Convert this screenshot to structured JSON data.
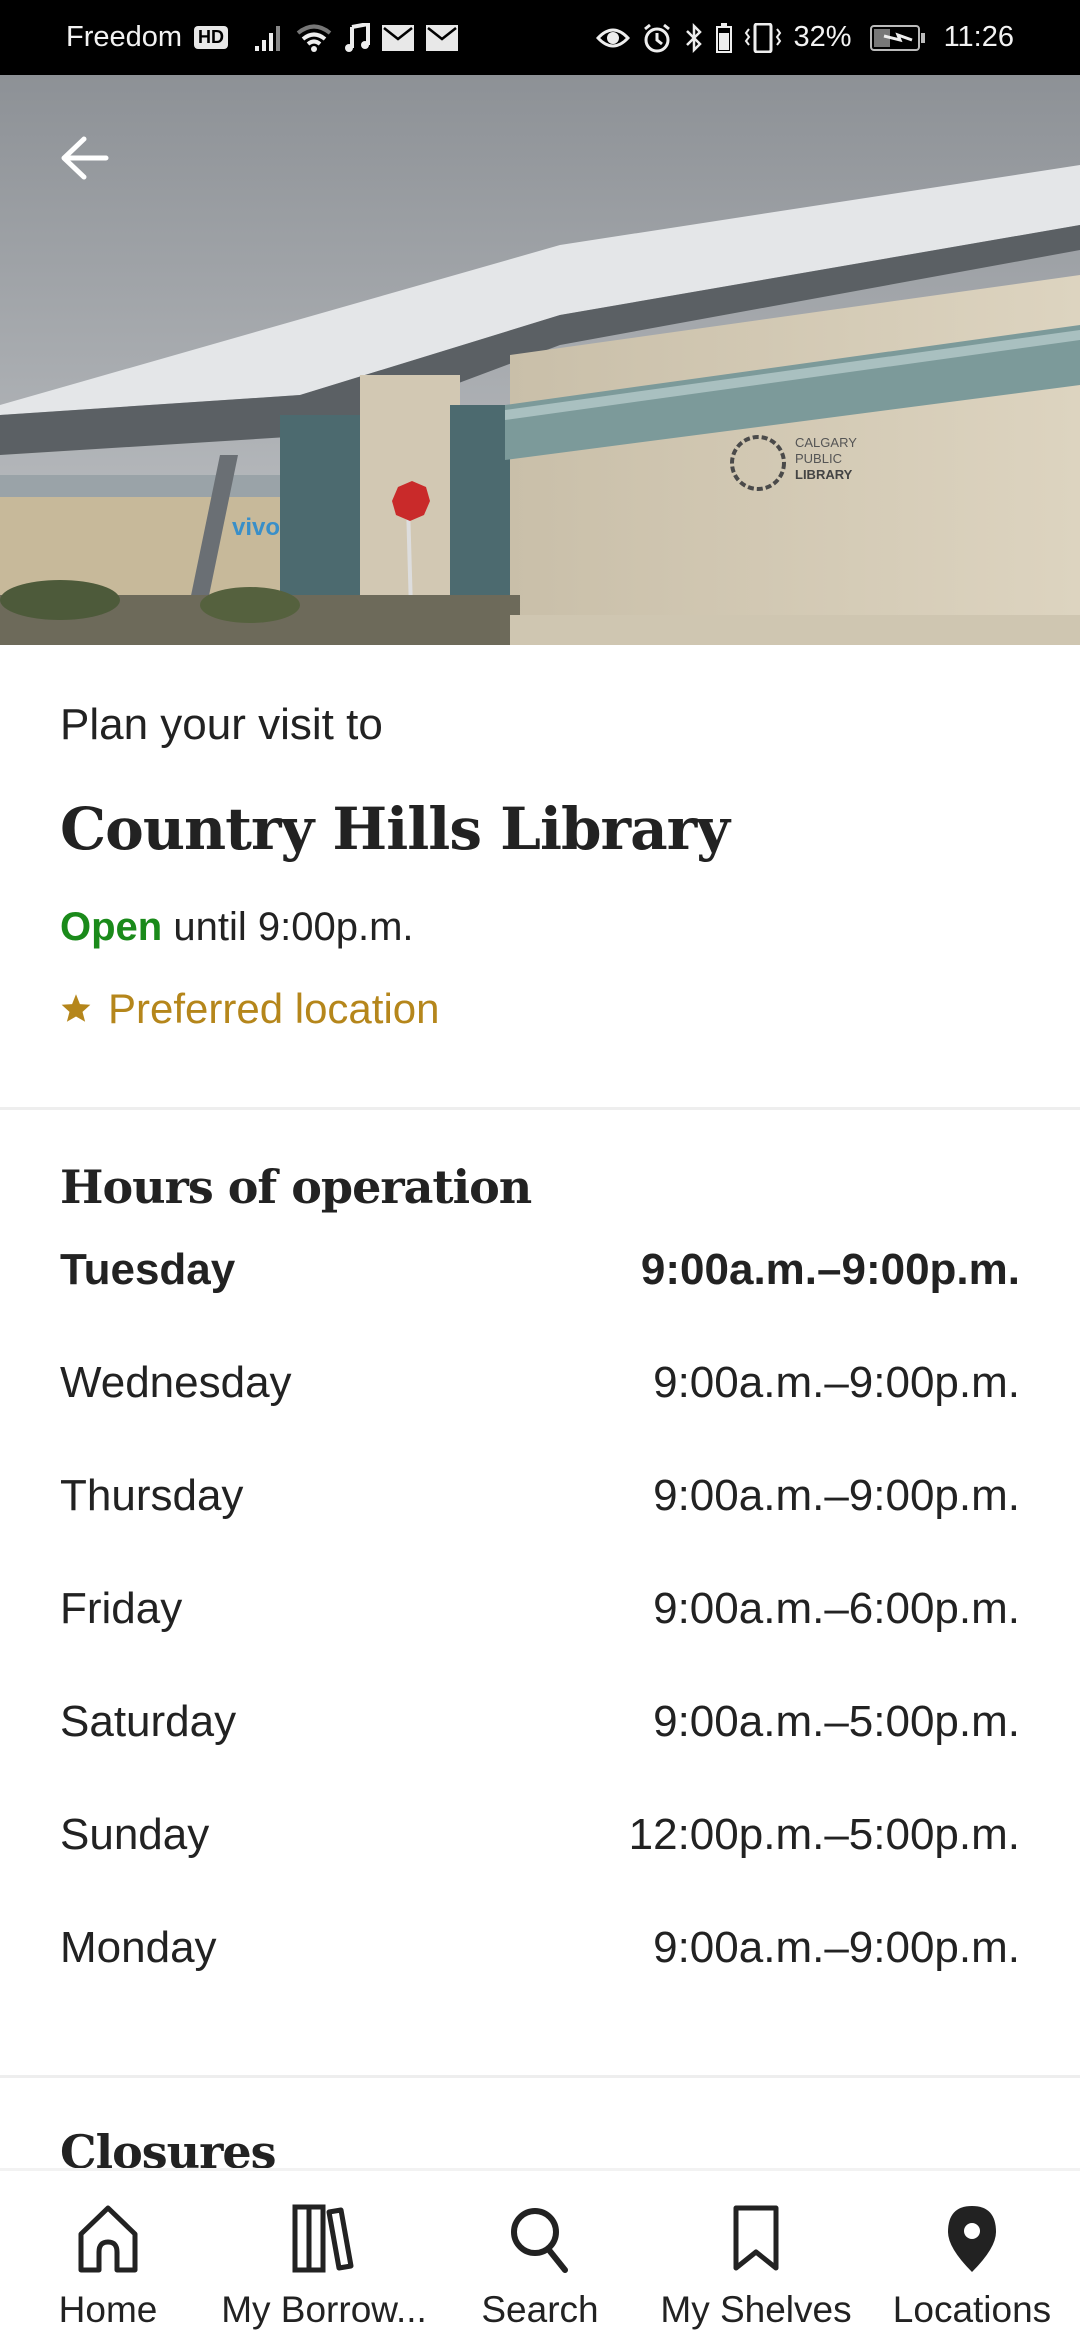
{
  "status_bar": {
    "carrier": "Freedom",
    "network_badge": "HD",
    "left_icons": [
      "signal-icon",
      "wifi-icon",
      "music-icon",
      "mail-icon",
      "mail-icon"
    ],
    "right_icons": [
      "eye-icon",
      "alarm-icon",
      "bluetooth-icon",
      "vibrate-icon"
    ],
    "battery_percent": "32%",
    "time": "11:26"
  },
  "header": {
    "back_icon": "arrow-left-icon",
    "hero_image_alt": "Country Hills Library building exterior",
    "building_sign": "CALGARY PUBLIC LIBRARY",
    "stop_sign": "STOP"
  },
  "intro": {
    "plan_label": "Plan your visit to",
    "library_name": "Country Hills Library",
    "open_status": "Open",
    "open_until": "until 9:00p.m.",
    "preferred_label": "Preferred location",
    "colors": {
      "open": "#1a8a1a",
      "preferred": "#b5861b"
    }
  },
  "hours": {
    "title": "Hours of operation",
    "rows": [
      {
        "day": "Tuesday",
        "hours": "9:00a.m.–9:00p.m.",
        "today": true
      },
      {
        "day": "Wednesday",
        "hours": "9:00a.m.–9:00p.m.",
        "today": false
      },
      {
        "day": "Thursday",
        "hours": "9:00a.m.–9:00p.m.",
        "today": false
      },
      {
        "day": "Friday",
        "hours": "9:00a.m.–6:00p.m.",
        "today": false
      },
      {
        "day": "Saturday",
        "hours": "9:00a.m.–5:00p.m.",
        "today": false
      },
      {
        "day": "Sunday",
        "hours": "12:00p.m.–5:00p.m.",
        "today": false
      },
      {
        "day": "Monday",
        "hours": "9:00a.m.–9:00p.m.",
        "today": false
      }
    ]
  },
  "closures": {
    "title": "Closures"
  },
  "bottom_nav": {
    "items": [
      {
        "label": "Home",
        "icon": "home-icon"
      },
      {
        "label": "My Borrow...",
        "icon": "books-icon"
      },
      {
        "label": "Search",
        "icon": "search-icon"
      },
      {
        "label": "My Shelves",
        "icon": "bookmark-icon"
      },
      {
        "label": "Locations",
        "icon": "location-pin-icon"
      }
    ]
  }
}
